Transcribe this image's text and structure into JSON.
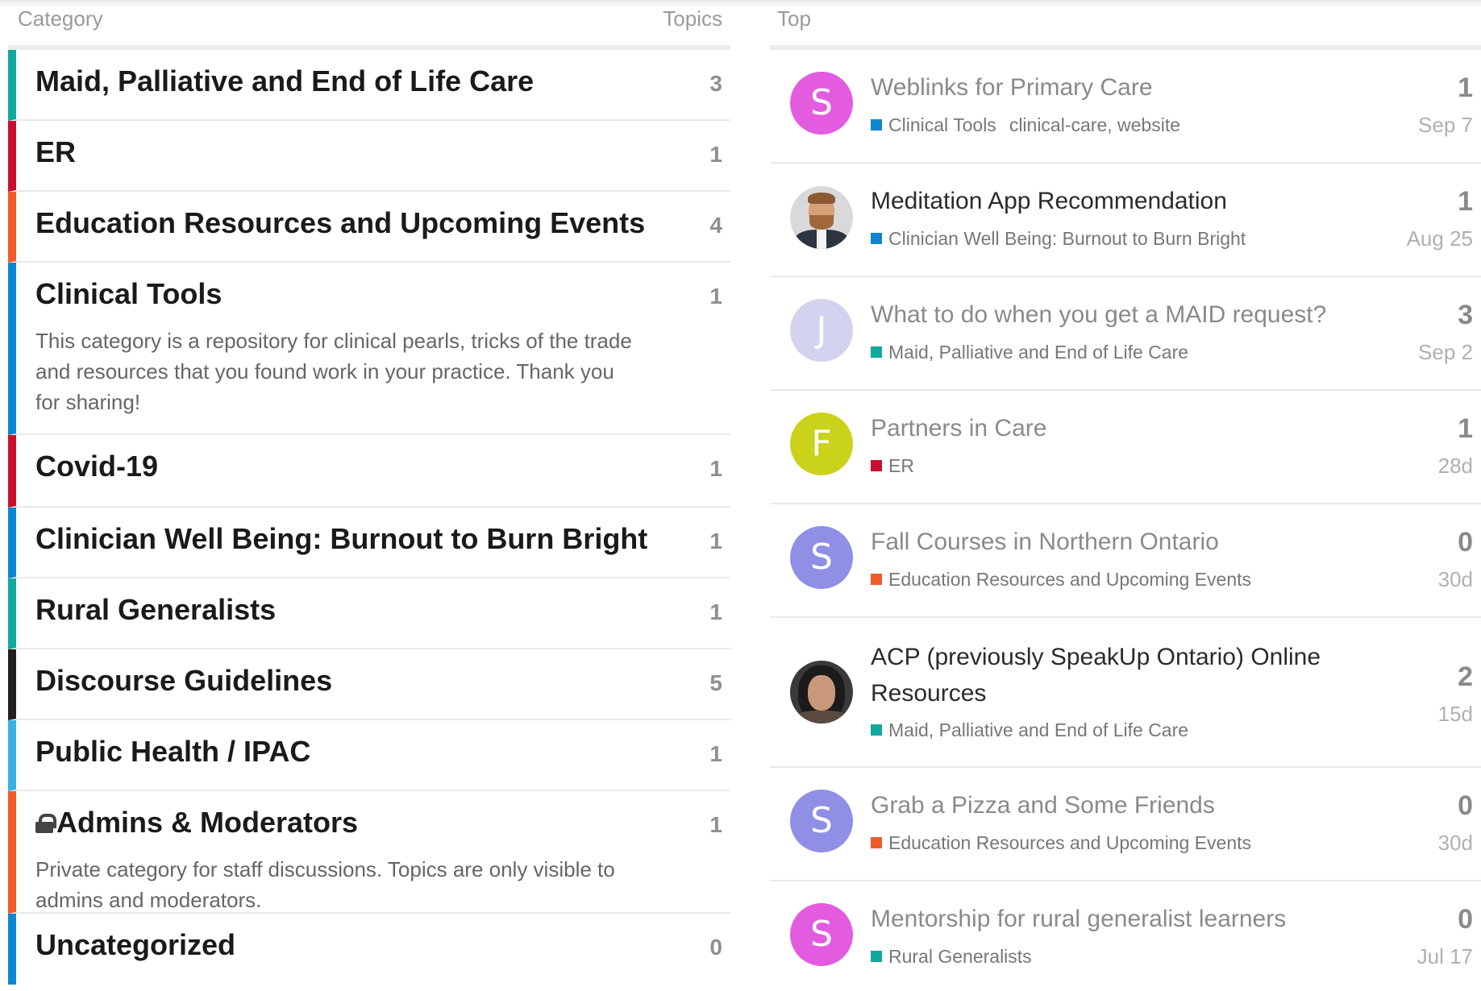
{
  "colors": {
    "teal": "#12a89d",
    "red": "#c8102e",
    "orange": "#f15a29",
    "blue": "#0e86cf",
    "black": "#231f20",
    "lightblue": "#3ab0e2"
  },
  "categories": {
    "header": {
      "category": "Category",
      "topics": "Topics"
    },
    "items": [
      {
        "name": "Maid, Palliative and End of Life Care",
        "count": "3",
        "color": "#12a89d",
        "description": ""
      },
      {
        "name": "ER",
        "count": "1",
        "color": "#c8102e",
        "description": ""
      },
      {
        "name": "Education Resources and Upcoming Events",
        "count": "4",
        "color": "#f15a29",
        "description": ""
      },
      {
        "name": "Clinical Tools",
        "count": "1",
        "color": "#0e86cf",
        "description": "This category is a repository for clinical pearls, tricks of the trade and resources that you found work in your practice. Thank you for sharing!"
      },
      {
        "name": "Covid-19",
        "count": "1",
        "color": "#c8102e",
        "description": ""
      },
      {
        "name": "Clinician Well Being: Burnout to Burn Bright",
        "count": "1",
        "color": "#0e86cf",
        "description": ""
      },
      {
        "name": "Rural Generalists",
        "count": "1",
        "color": "#12a89d",
        "description": ""
      },
      {
        "name": "Discourse Guidelines",
        "count": "5",
        "color": "#231f20",
        "description": ""
      },
      {
        "name": "Public Health / IPAC",
        "count": "1",
        "color": "#3ab0e2",
        "description": ""
      },
      {
        "name": "Admins & Moderators",
        "count": "1",
        "color": "#f15a29",
        "description": "Private category for staff discussions. Topics are only visible to admins and moderators.",
        "locked": true
      },
      {
        "name": "Uncategorized",
        "count": "0",
        "color": "#0e86cf",
        "description": ""
      }
    ]
  },
  "top": {
    "header": "Top",
    "topics": [
      {
        "title": "Weblinks for Primary Care",
        "category": "Clinical Tools",
        "category_color": "#0e86cf",
        "tags": "clinical-care, website",
        "replies": "1",
        "date": "Sep 7",
        "avatar_letter": "S",
        "avatar_color": "#e35ce0",
        "read": false
      },
      {
        "title": "Meditation App Recommendation",
        "category": "Clinician Well Being: Burnout to Burn Bright",
        "category_color": "#0e86cf",
        "tags": "",
        "replies": "1",
        "date": "Aug 25",
        "avatar_letter": "",
        "avatar_color": "#d9d9d9",
        "read": true
      },
      {
        "title": "What to do when you get a MAID request?",
        "category": "Maid, Palliative and End of Life Care",
        "category_color": "#12a89d",
        "tags": "",
        "replies": "3",
        "date": "Sep 2",
        "avatar_letter": "J",
        "avatar_color": "#d3d3f0",
        "read": false
      },
      {
        "title": "Partners in Care",
        "category": "ER",
        "category_color": "#c8102e",
        "tags": "",
        "replies": "1",
        "date": "28d",
        "avatar_letter": "F",
        "avatar_color": "#cbd21a",
        "read": false
      },
      {
        "title": "Fall Courses in Northern Ontario",
        "category": "Education Resources and Upcoming Events",
        "category_color": "#f15a29",
        "tags": "",
        "replies": "0",
        "date": "30d",
        "avatar_letter": "S",
        "avatar_color": "#8f8fe6",
        "read": false
      },
      {
        "title": "ACP (previously SpeakUp Ontario) Online Resources",
        "category": "Maid, Palliative and End of Life Care",
        "category_color": "#12a89d",
        "tags": "",
        "replies": "2",
        "date": "15d",
        "avatar_letter": "",
        "avatar_color": "#3a3a3a",
        "read": true
      },
      {
        "title": "Grab a Pizza and Some Friends",
        "category": "Education Resources and Upcoming Events",
        "category_color": "#f15a29",
        "tags": "",
        "replies": "0",
        "date": "30d",
        "avatar_letter": "S",
        "avatar_color": "#8f8fe6",
        "read": false
      },
      {
        "title": "Mentorship for rural generalist learners",
        "category": "Rural Generalists",
        "category_color": "#12a89d",
        "tags": "",
        "replies": "0",
        "date": "Jul 17",
        "avatar_letter": "S",
        "avatar_color": "#e35ce0",
        "read": false
      }
    ]
  }
}
